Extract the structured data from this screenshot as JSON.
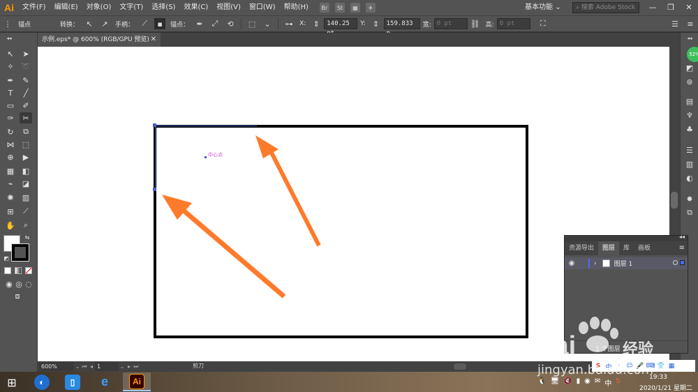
{
  "app": {
    "logo": "Ai",
    "menus": [
      "文件(F)",
      "编辑(E)",
      "对象(O)",
      "文字(T)",
      "选择(S)",
      "效果(C)",
      "视图(V)",
      "窗口(W)",
      "帮助(H)"
    ],
    "menu_icons": [
      "Br",
      "St"
    ],
    "workspace": "基本功能",
    "stock_search_placeholder": "搜索 Adobe Stock",
    "window_buttons": [
      "—",
      "❐",
      "✕"
    ]
  },
  "control_bar": {
    "anchor_label": "锚点",
    "convert_label": "转换：",
    "handle_label": "手柄：",
    "anchors_label": "锚点：",
    "x_label": "X:",
    "x_value": "140.25 pt",
    "y_label": "Y:",
    "y_value": "159.833 p",
    "w_label": "宽:",
    "w_value": "0 pt",
    "h_label": "高:",
    "h_value": "0 pt"
  },
  "document": {
    "tab_title": "示例.eps* @ 600% (RGB/GPU 预览)",
    "close": "✕",
    "center_label": "中心点"
  },
  "layers_panel": {
    "tabs": [
      "资源导出",
      "图层",
      "库",
      "画板"
    ],
    "active_tab": 1,
    "menu": "≡",
    "collapse": "◂◂",
    "layer_name": "图层 1",
    "layer_count": "1 个图层"
  },
  "status_bar": {
    "zoom": "600%",
    "page": "1",
    "tool_name": "剪刀"
  },
  "taskbar": {
    "time": "19:33",
    "date": "2020/1/21 星期二",
    "ime": "中"
  },
  "watermark": {
    "line1": "Bai",
    "line1b": "经验",
    "line2": "jingyan.baidu.com"
  },
  "colors": {
    "accent_orange": "#ff7a2a",
    "selection_blue": "#4a5cc8",
    "center_label_color": "#d34bd3",
    "ai_orange": "#ff9a00"
  }
}
